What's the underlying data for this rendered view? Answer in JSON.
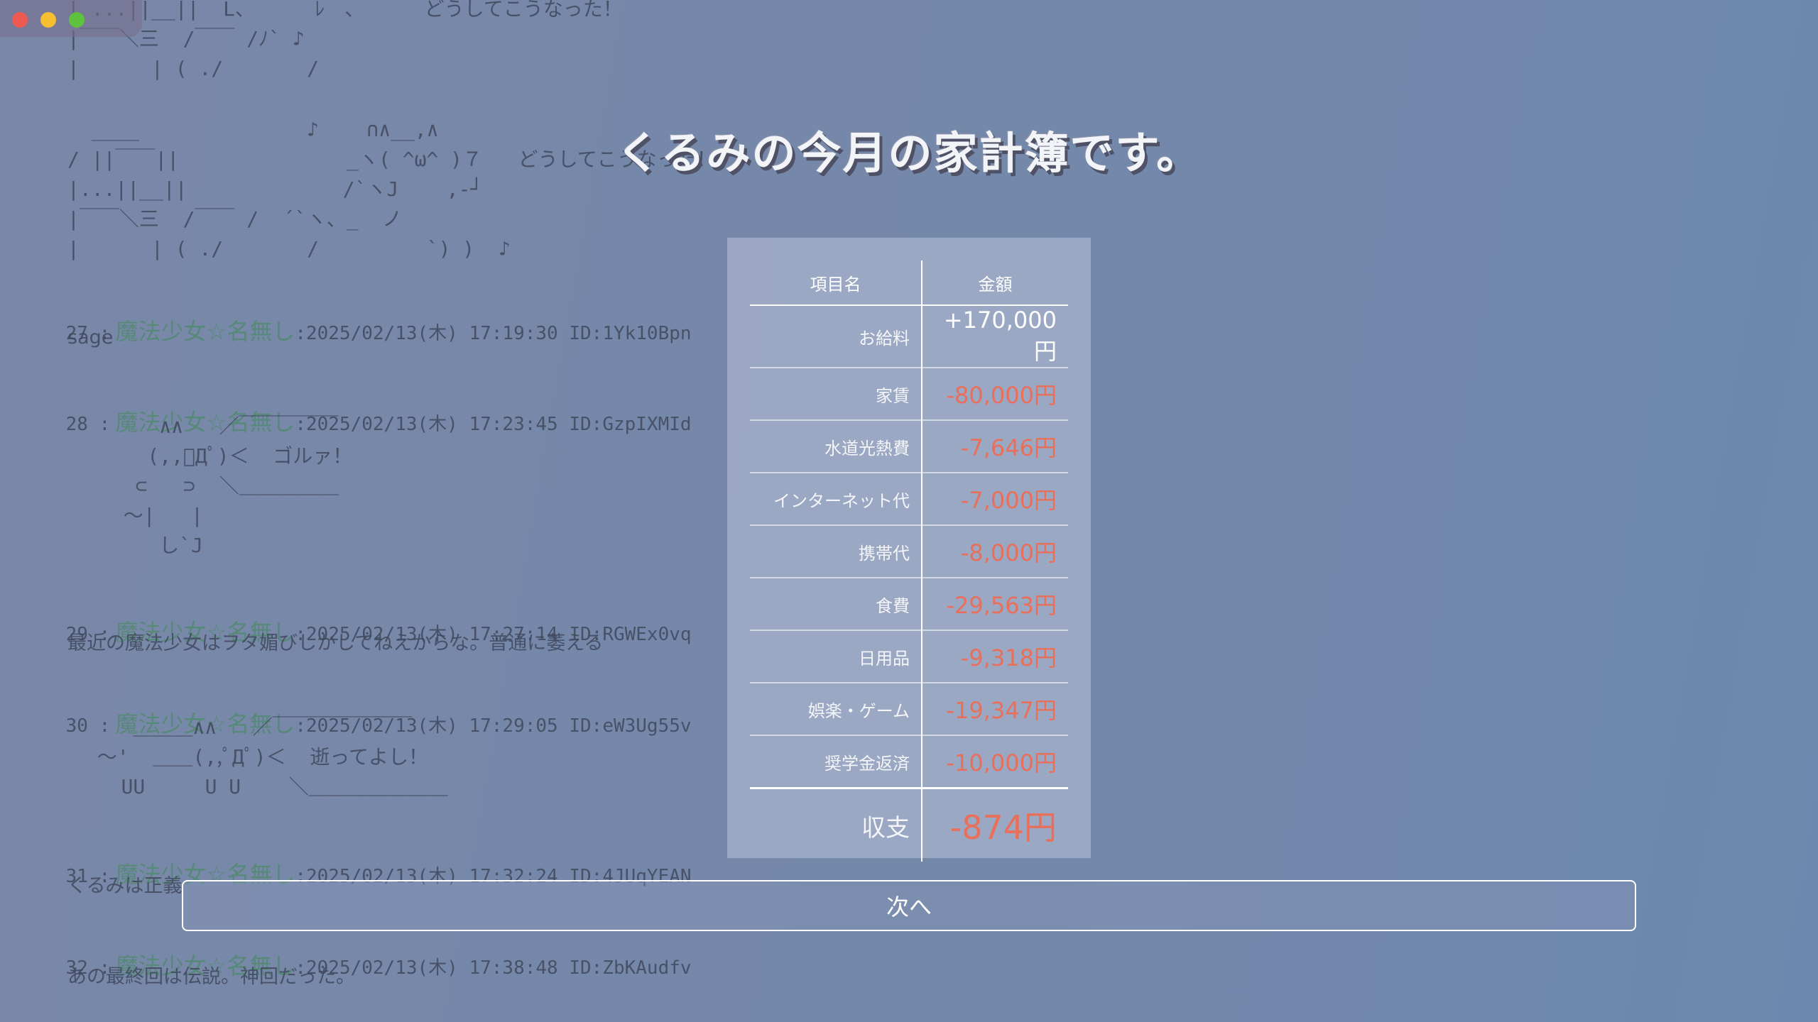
{
  "title": "くるみの今月の家計簿です。",
  "ledger": {
    "header_item": "項目名",
    "header_amount": "金額",
    "rows": [
      {
        "label": "お給料",
        "amount": "+170,000円"
      },
      {
        "label": "家賃",
        "amount": "-80,000円"
      },
      {
        "label": "水道光熱費",
        "amount": "-7,646円"
      },
      {
        "label": "インターネット代",
        "amount": "-7,000円"
      },
      {
        "label": "携帯代",
        "amount": "-8,000円"
      },
      {
        "label": "食費",
        "amount": "-29,563円"
      },
      {
        "label": "日用品",
        "amount": "-9,318円"
      },
      {
        "label": "娯楽・ゲーム",
        "amount": "-19,347円"
      },
      {
        "label": "奨学金返済",
        "amount": "-10,000円"
      }
    ],
    "total_label": "収支",
    "total_amount": "-874円"
  },
  "next_button": "次へ",
  "thread": {
    "aa_top": "| ...||__||  L、     ﾚ＾、     どうしてこうなった！\n|￣￣＼三  /￣￣ /ﾉ` ♪\n|      | ( ./       /",
    "aa_dance": "  ____              ♪    ∩∧__,∧\n/ ||￣￣||              _ヽ( ^ω^ )７   どうしてこうなった！\n|...||__||             /`ヽJ    ,‐┘\n|￣￣＼三  /￣￣ /  ´`ヽ、_  ノ\n|      | ( ./       /         `) )  ♪",
    "posts": [
      {
        "num": "27 :",
        "name": "魔法少女☆名無し",
        "meta": ":2025/02/13(木) 17:19:30 ID:1Yk10Bpn",
        "body": "sage"
      },
      {
        "num": "28 :",
        "name": "魔法少女☆名無し",
        "meta": ":2025/02/13(木) 17:23:45 ID:GzpIXMId",
        "body": ""
      },
      {
        "num": "29 :",
        "name": "魔法少女☆名無し",
        "meta": ":2025/02/13(木) 17:27:14 ID:RGWEx0vq",
        "body": "最近の魔法少女はヲタ媚びしかしてねえからな。普通に萎える"
      },
      {
        "num": "30 :",
        "name": "魔法少女☆名無し",
        "meta": ":2025/02/13(木) 17:29:05 ID:eW3Ug55v",
        "body": ""
      },
      {
        "num": "31 :",
        "name": "魔法少女☆名無し",
        "meta": ":2025/02/13(木) 17:32:24 ID:4JUqYEAN",
        "body": "くるみは正義"
      },
      {
        "num": "32 :",
        "name": "魔法少女☆名無し",
        "meta": ":2025/02/13(木) 17:38:48 ID:ZbKAudfv",
        "body": "あの最終回は伝説。神回だった。"
      }
    ],
    "aa_28": "     ∧∧   ／￣￣￣￣￣\n    (,,ﾟДﾟ)＜  ゴルァ！\n   ⊂   ⊃  ＼＿＿＿＿＿\n  ～|   |\n     し`J",
    "aa_30": "    ＿＿＿∧∧   ／￣￣￣￣￣￣￣\n ～'  ＿＿(,,ﾟДﾟ)＜  逝ってよし！\n   UU     U U    ＼＿＿＿＿＿＿＿"
  }
}
